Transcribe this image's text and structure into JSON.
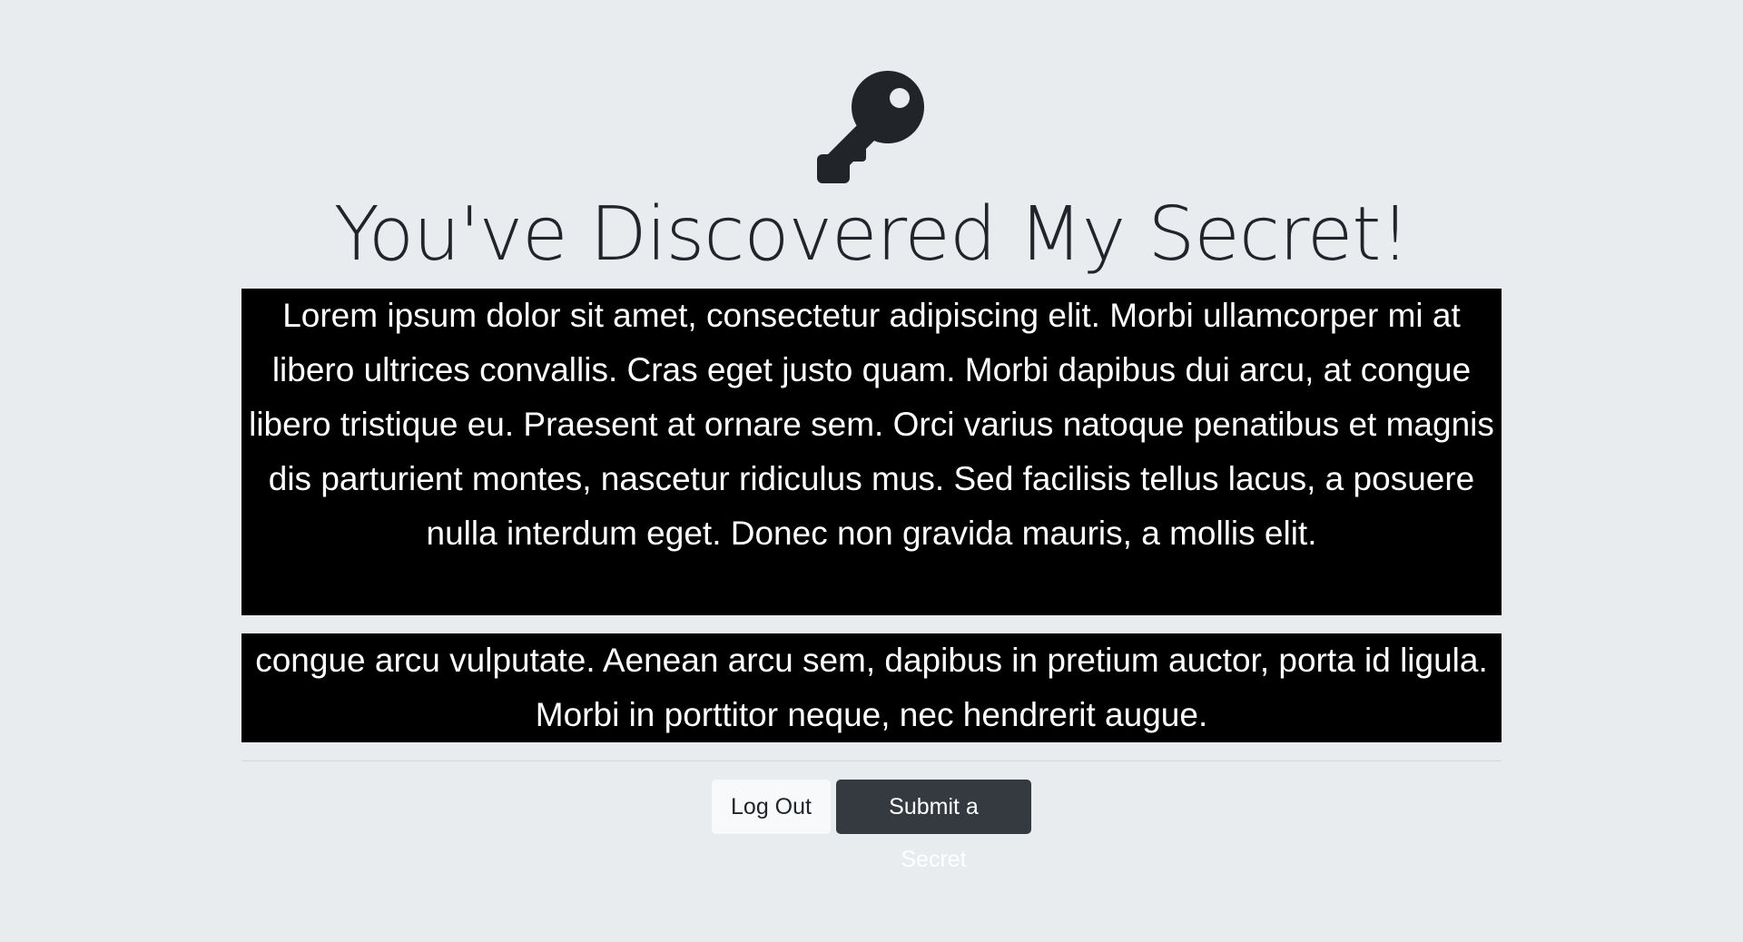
{
  "page": {
    "icon": "key-icon",
    "title": "You've Discovered My Secret!"
  },
  "secrets": [
    {
      "text": "Lorem ipsum dolor sit amet, consectetur adipiscing elit. Morbi ullamcorper mi at libero ultrices convallis. Cras eget justo quam. Morbi dapibus dui arcu, at congue libero tristique eu. Praesent at ornare sem. Orci varius natoque penatibus et magnis dis parturient montes, nascetur ridiculus mus. Sed facilisis tellus lacus, a posuere nulla interdum eget. Donec non gravida mauris, a mollis elit."
    },
    {
      "text": "congue arcu vulputate. Aenean arcu sem, dapibus in pretium auctor, porta id ligula. Morbi in porttitor neque, nec hendrerit augue."
    }
  ],
  "actions": {
    "logout_label": "Log Out",
    "submit_label": "Submit a Secret"
  },
  "colors": {
    "background": "#e9ecef",
    "secret_background": "#000000",
    "secret_text": "#ffffff",
    "light_button": "#f8f9fa",
    "dark_button": "#343a40"
  }
}
